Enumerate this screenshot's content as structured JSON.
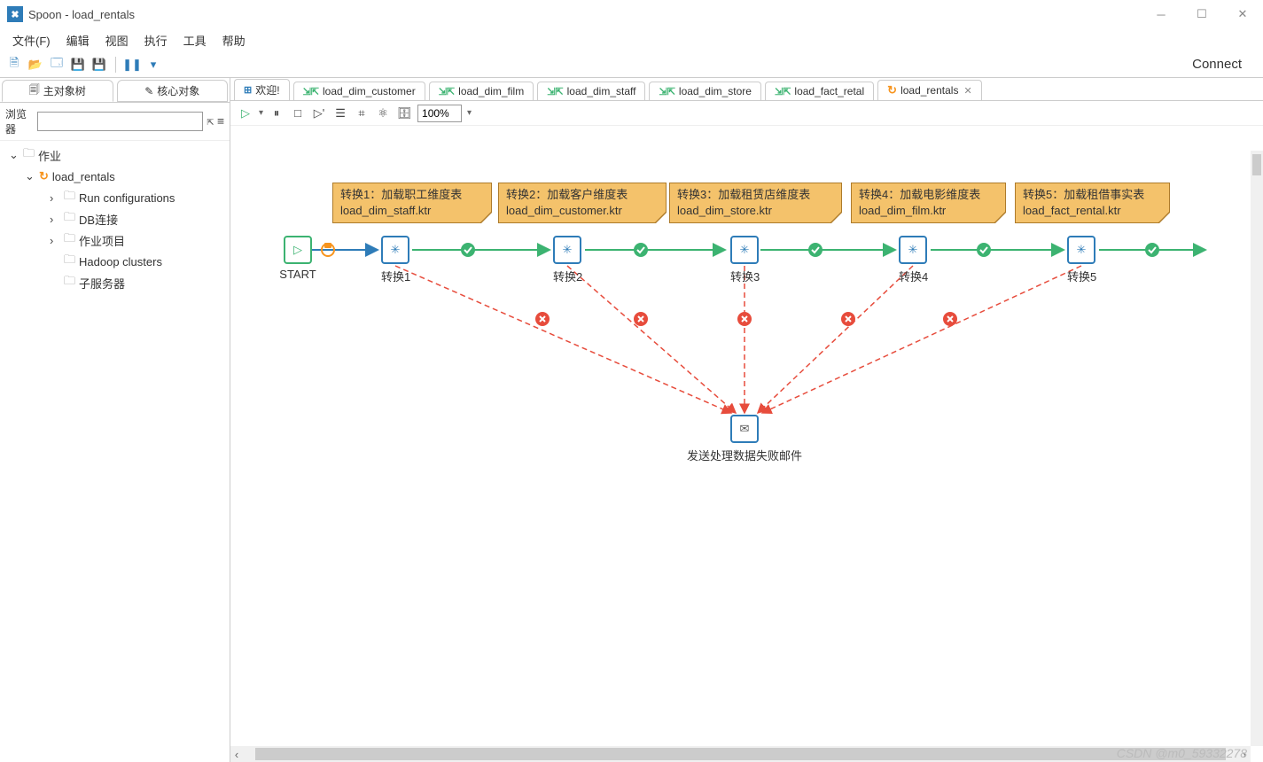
{
  "window": {
    "title": "Spoon - load_rentals"
  },
  "menu": {
    "file": "文件(F)",
    "edit": "编辑",
    "view": "视图",
    "execute": "执行",
    "tools": "工具",
    "help": "帮助"
  },
  "toolbar": {
    "connect": "Connect"
  },
  "sidebar": {
    "tabs": {
      "main": "主对象树",
      "core": "核心对象"
    },
    "search_label": "浏览器",
    "tree": {
      "root": "作业",
      "job": "load_rentals",
      "items": [
        "Run configurations",
        "DB连接",
        "作业项目",
        "Hadoop clusters",
        "子服务器"
      ]
    }
  },
  "tabs": [
    "欢迎!",
    "load_dim_customer",
    "load_dim_film",
    "load_dim_staff",
    "load_dim_store",
    "load_fact_retal",
    "load_rentals"
  ],
  "canvas_toolbar": {
    "zoom": "100%"
  },
  "canvas": {
    "start_label": "START",
    "transforms": [
      "转换1",
      "转换2",
      "转换3",
      "转换4",
      "转换5"
    ],
    "notes": [
      {
        "line1": "转换1：加载职工维度表",
        "line2": "load_dim_staff.ktr"
      },
      {
        "line1": "转换2：加载客户维度表",
        "line2": "load_dim_customer.ktr"
      },
      {
        "line1": "转换3：加载租赁店维度表",
        "line2": "load_dim_store.ktr"
      },
      {
        "line1": "转换4：加载电影维度表",
        "line2": "load_dim_film.ktr"
      },
      {
        "line1": "转换5：加载租借事实表",
        "line2": "load_fact_rental.ktr"
      }
    ],
    "mail_label": "发送处理数据失败邮件"
  },
  "watermark": "CSDN @m0_59332278"
}
